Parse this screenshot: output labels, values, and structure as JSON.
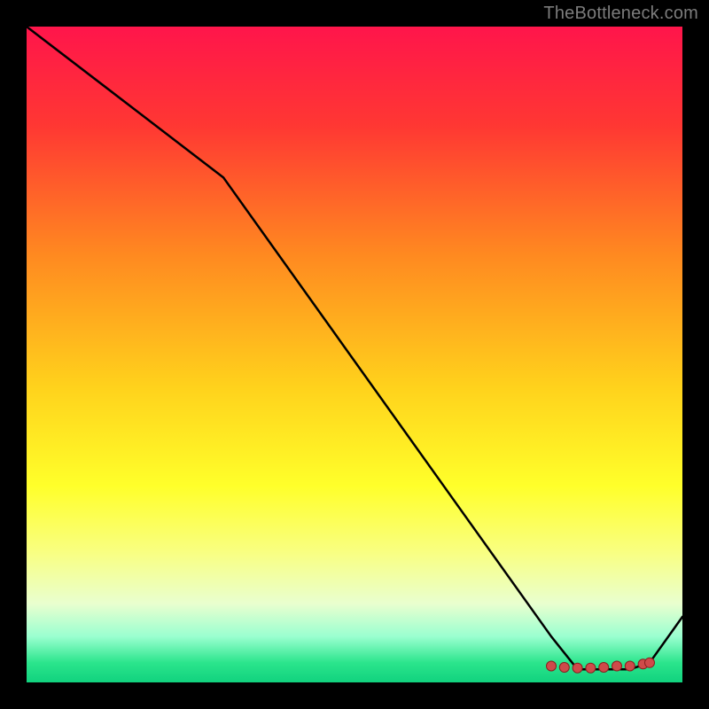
{
  "watermark": "TheBottleneck.com",
  "chart_data": {
    "type": "line",
    "title": "",
    "xlabel": "",
    "ylabel": "",
    "xlim": [
      0,
      100
    ],
    "ylim": [
      0,
      100
    ],
    "grid": false,
    "series": [
      {
        "name": "curve",
        "x": [
          0,
          30,
          80,
          84,
          92,
          95,
          100
        ],
        "values": [
          100,
          77,
          7,
          2,
          2,
          3,
          10
        ]
      }
    ],
    "markers": {
      "name": "bottom-cluster",
      "x": [
        80,
        82,
        84,
        86,
        88,
        90,
        92,
        94,
        95
      ],
      "values": [
        2.5,
        2.3,
        2.2,
        2.2,
        2.3,
        2.5,
        2.5,
        2.8,
        3.0
      ]
    },
    "gradient_stops": [
      {
        "offset": 0,
        "color": "#ff154b"
      },
      {
        "offset": 15,
        "color": "#ff3733"
      },
      {
        "offset": 35,
        "color": "#ff8a20"
      },
      {
        "offset": 55,
        "color": "#ffd21c"
      },
      {
        "offset": 70,
        "color": "#ffff2a"
      },
      {
        "offset": 80,
        "color": "#f9ff80"
      },
      {
        "offset": 88,
        "color": "#e9ffcf"
      },
      {
        "offset": 93,
        "color": "#9affd0"
      },
      {
        "offset": 97,
        "color": "#2be58c"
      },
      {
        "offset": 100,
        "color": "#11d27e"
      }
    ]
  }
}
